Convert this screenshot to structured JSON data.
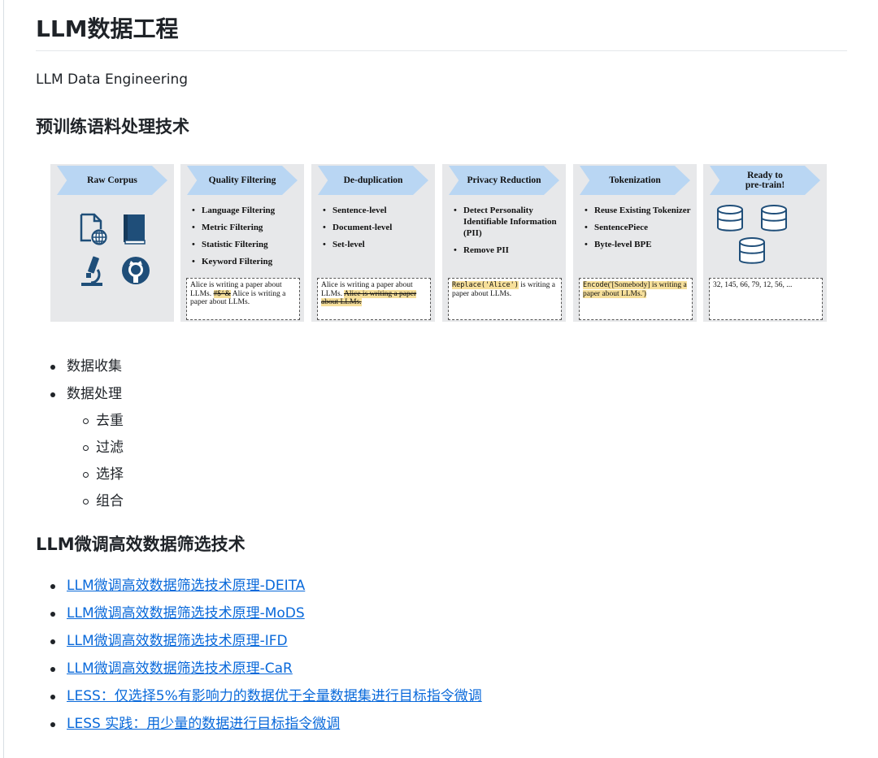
{
  "title": "LLM数据工程",
  "subtitle": "LLM Data Engineering",
  "section1": {
    "heading": "预训练语料处理技术",
    "figure": {
      "stages": [
        {
          "label": "Raw Corpus"
        },
        {
          "label": "Quality Filtering",
          "bullets": [
            "Language Filtering",
            "Metric Filtering",
            "Statistic Filtering",
            "Keyword Filtering"
          ],
          "example": {
            "pre": "Alice is writing a paper about LLMs. ",
            "strike": "#$^&",
            "post": " Alice is writing a paper about LLMs."
          }
        },
        {
          "label": "De-duplication",
          "bullets": [
            "Sentence-level",
            "Document-level",
            "Set-level"
          ],
          "example": {
            "pre": "Alice is writing a paper about LLMs. ",
            "strike": "Alice is writing a paper about LLMs."
          }
        },
        {
          "label": "Privacy Reduction",
          "bullets": [
            "Detect Personality Identifiable Information (PII)",
            "Remove PII"
          ],
          "example": {
            "code": "Replace('Alice')",
            "post": " is writing a paper about LLMs."
          }
        },
        {
          "label": "Tokenization",
          "bullets": [
            "Reuse Existing Tokenizer",
            "SentencePiece",
            "Byte-level BPE"
          ],
          "example": {
            "code": "Encode",
            "hl": "('[Somebody] is writing a paper about LLMs.')"
          }
        },
        {
          "label_line1": "Ready to",
          "label_line2": "pre-train!",
          "example": {
            "text": "32, 145, 66, 79, 12, 56, ..."
          }
        }
      ]
    },
    "items": [
      {
        "label": "数据收集"
      },
      {
        "label": "数据处理",
        "children": [
          "去重",
          "过滤",
          "选择",
          "组合"
        ]
      }
    ]
  },
  "section2": {
    "heading": "LLM微调高效数据筛选技术",
    "links": [
      "LLM微调高效数据筛选技术原理-DEITA",
      "LLM微调高效数据筛选技术原理-MoDS",
      "LLM微调高效数据筛选技术原理-IFD",
      "LLM微调高效数据筛选技术原理-CaR",
      "LESS：仅选择5%有影响力的数据优于全量数据集进行目标指令微调",
      "LESS 实践：用少量的数据进行目标指令微调"
    ]
  },
  "colors": {
    "link": "#0969da",
    "arrow": "#b9d6f3",
    "panel": "#e7e8ea",
    "highlight": "#f6df9a"
  },
  "icons": [
    "document-globe-icon",
    "book-icon",
    "microscope-icon",
    "github-icon",
    "database-icon"
  ]
}
